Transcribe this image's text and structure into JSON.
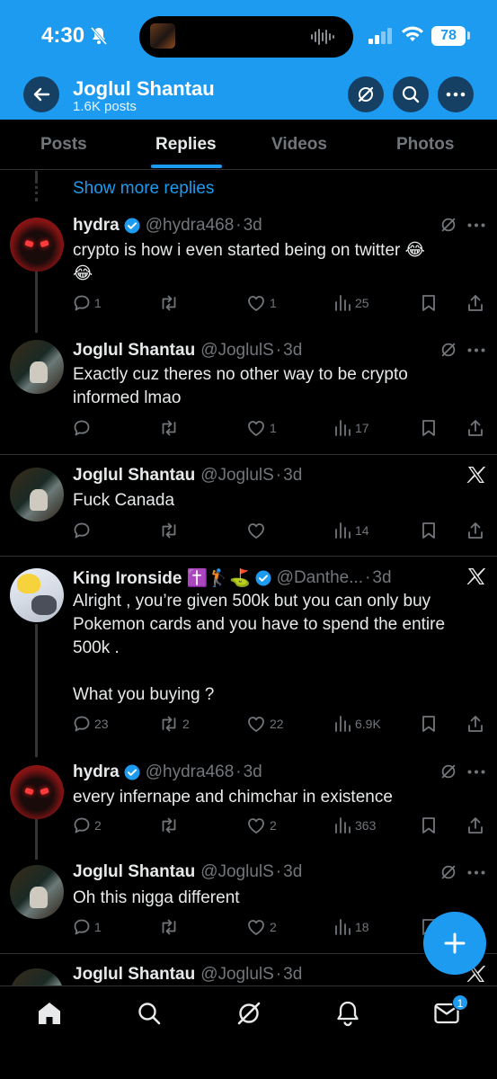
{
  "status_bar": {
    "time": "4:30",
    "battery": "78"
  },
  "header": {
    "title": "Joglul Shantau",
    "subtitle": "1.6K posts"
  },
  "tabs": [
    {
      "label": "Posts",
      "active": false
    },
    {
      "label": "Replies",
      "active": true
    },
    {
      "label": "Videos",
      "active": false
    },
    {
      "label": "Photos",
      "active": false
    }
  ],
  "show_more": "Show more replies",
  "tweets": [
    {
      "name": "hydra",
      "handle": "@hydra468",
      "time": "3d",
      "verified": true,
      "text": "crypto is how i even started being on twitter 😂\n😂",
      "replies": "1",
      "retweets": "",
      "likes": "1",
      "views": "25"
    },
    {
      "name": "Joglul Shantau",
      "handle": "@JoglulS",
      "time": "3d",
      "verified": false,
      "text": "Exactly cuz theres no other way to be crypto\ninformed lmao",
      "replies": "",
      "retweets": "",
      "likes": "1",
      "views": "17"
    },
    {
      "name": "Joglul Shantau",
      "handle": "@JoglulS",
      "time": "3d",
      "verified": false,
      "text": "Fuck Canada",
      "replies": "",
      "retweets": "",
      "likes": "",
      "views": "14"
    },
    {
      "name": "King Ironside ✝️🏌️⛳",
      "handle": "@Danthe...",
      "time": "3d",
      "verified": true,
      "text": "Alright , you’re given 500k but you can only buy\nPokemon cards and you have to spend the entire\n500k .\n\nWhat you buying ?",
      "replies": "23",
      "retweets": "2",
      "likes": "22",
      "views": "6.9K"
    },
    {
      "name": "hydra",
      "handle": "@hydra468",
      "time": "3d",
      "verified": true,
      "text": "every infernape and chimchar in existence",
      "replies": "2",
      "retweets": "",
      "likes": "2",
      "views": "363"
    },
    {
      "name": "Joglul Shantau",
      "handle": "@JoglulS",
      "time": "3d",
      "verified": false,
      "text": "Oh this nigga different",
      "replies": "1",
      "retweets": "",
      "likes": "2",
      "views": "18"
    },
    {
      "name": "Joglul Shantau",
      "handle": "@JoglulS",
      "time": "3d",
      "verified": false,
      "text": "",
      "replies": "",
      "retweets": "",
      "likes": "",
      "views": ""
    }
  ],
  "nav": {
    "messages_badge": "1"
  },
  "colors": {
    "accent": "#1d9bf0",
    "background": "#000000",
    "muted": "#71767b",
    "divider": "#2f3336"
  },
  "icons": [
    "back-arrow-icon",
    "grok-icon",
    "search-icon",
    "more-icon",
    "reply-icon",
    "retweet-icon",
    "like-icon",
    "views-icon",
    "bookmark-icon",
    "share-icon",
    "x-logo-icon",
    "compose-plus-icon",
    "home-icon",
    "notifications-icon",
    "messages-icon"
  ]
}
